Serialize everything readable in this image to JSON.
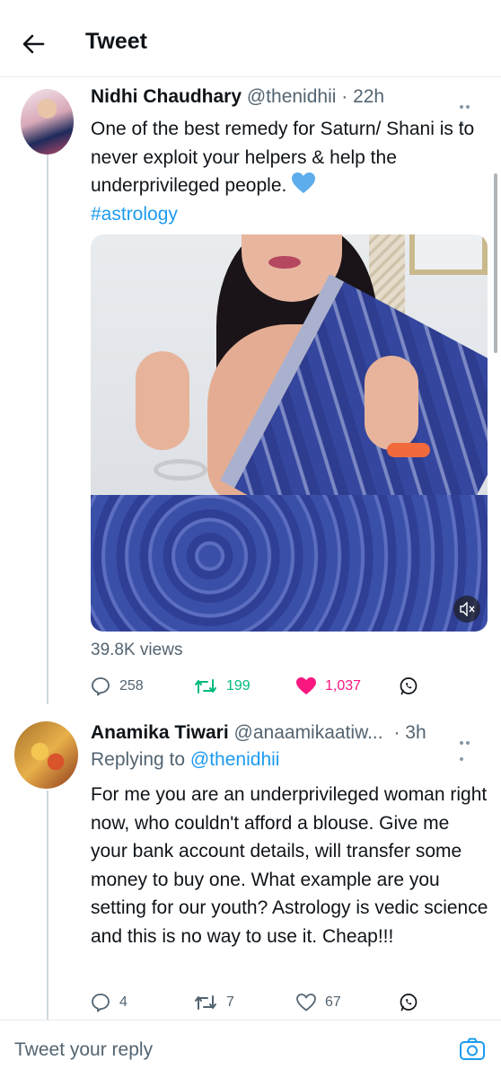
{
  "header": {
    "title": "Tweet"
  },
  "tweet": {
    "name": "Nidhi Chaudhary",
    "handle": "@thenidhii",
    "time": "· 22h",
    "text": "One of the best remedy for Saturn/ Shani is to never exploit your helpers & help the underprivileged people.",
    "hashtag": "#astrology",
    "views": "39.8K views",
    "replies": "258",
    "retweets": "199",
    "likes": "1,037"
  },
  "reply": {
    "name": "Anamika Tiwari",
    "handle": "@anaamikaatiw...",
    "time": "· 3h",
    "replying_label": "Replying to",
    "replying_to": "@thenidhii",
    "text": "For me you are an underprivileged woman right now, who couldn't afford a blouse. Give me your bank account details, will transfer some money to buy one. What example are you setting for our youth? Astrology is vedic science and this is no way to use it. Cheap!!!",
    "replies": "4",
    "retweets": "7",
    "likes": "67"
  },
  "composer": {
    "placeholder": "Tweet your reply"
  },
  "colors": {
    "accent": "#1d9bf0",
    "retweet": "#00ba7c",
    "like": "#f91880",
    "secondary_text": "#536471"
  },
  "icons": [
    "back-arrow-icon",
    "more-icon",
    "blue-heart-icon",
    "mute-icon",
    "reply-icon",
    "retweet-icon",
    "like-icon",
    "share-icon",
    "camera-icon"
  ]
}
